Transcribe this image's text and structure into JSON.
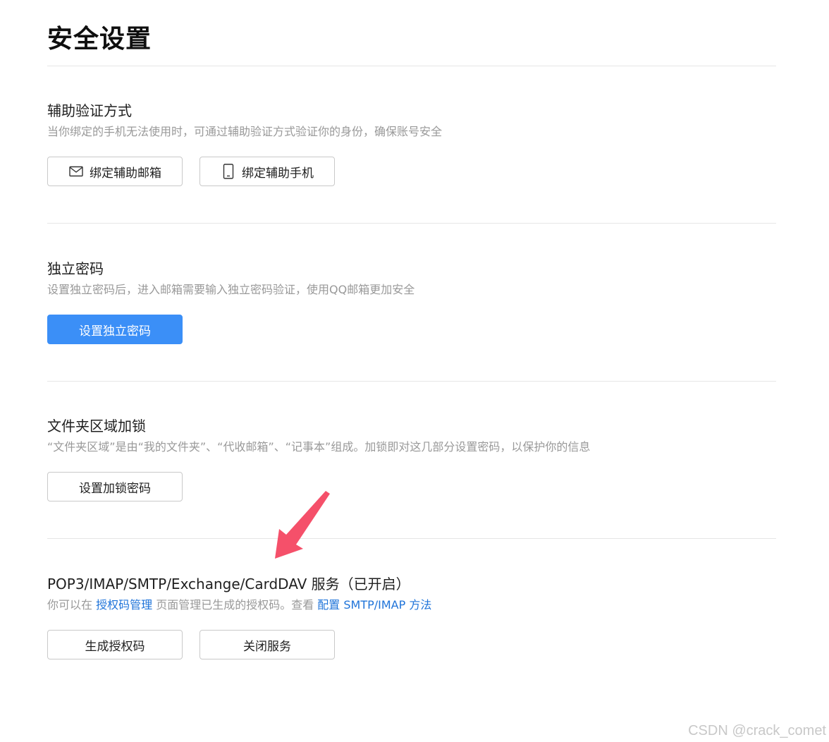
{
  "page": {
    "title": "安全设置"
  },
  "sections": [
    {
      "title": "辅助验证方式",
      "desc": "当你绑定的手机无法使用时，可通过辅助验证方式验证你的身份，确保账号安全",
      "buttons": [
        {
          "label": "绑定辅助邮箱",
          "icon": "mail-icon"
        },
        {
          "label": "绑定辅助手机",
          "icon": "phone-icon"
        }
      ]
    },
    {
      "title": "独立密码",
      "desc": "设置独立密码后，进入邮箱需要输入独立密码验证，使用QQ邮箱更加安全",
      "buttons": [
        {
          "label": "设置独立密码"
        }
      ]
    },
    {
      "title": "文件夹区域加锁",
      "desc": "“文件夹区域”是由“我的文件夹”、“代收邮箱”、“记事本”组成。加锁即对这几部分设置密码，以保护你的信息",
      "buttons": [
        {
          "label": "设置加锁密码"
        }
      ]
    },
    {
      "title": "POP3/IMAP/SMTP/Exchange/CardDAV 服务（已开启）",
      "desc_parts": {
        "pre": "你可以在 ",
        "link1": "授权码管理",
        "mid": " 页面管理已生成的授权码。查看 ",
        "link2": "配置 SMTP/IMAP 方法"
      },
      "buttons": [
        {
          "label": "生成授权码"
        },
        {
          "label": "关闭服务"
        }
      ]
    }
  ],
  "colors": {
    "primary": "#3b8ff7",
    "link": "#1e73d9",
    "annotation_arrow": "#f5506a",
    "muted_text": "#999999"
  },
  "watermark": "CSDN @crack_comet"
}
